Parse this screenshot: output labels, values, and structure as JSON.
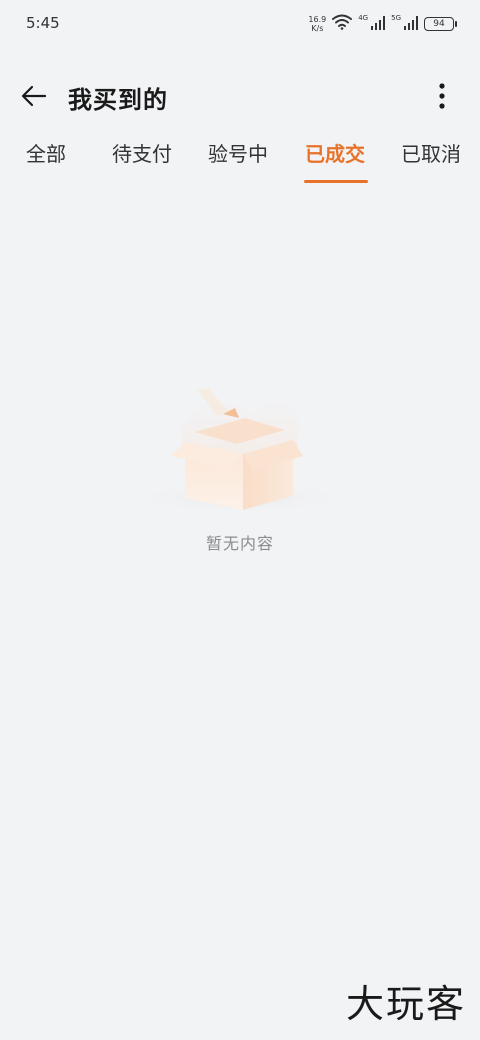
{
  "status_bar": {
    "time": "5:45",
    "net_speed_value": "16.9",
    "net_speed_unit": "K/s",
    "net_type_1": "4G",
    "net_type_2": "5G",
    "battery": "94"
  },
  "header": {
    "title": "我买到的",
    "back_icon": "arrow-left-icon",
    "more_icon": "more-vertical-icon"
  },
  "tabs": [
    {
      "label": "全部",
      "active": false
    },
    {
      "label": "待支付",
      "active": false
    },
    {
      "label": "验号中",
      "active": false
    },
    {
      "label": "已成交",
      "active": true
    },
    {
      "label": "已取消",
      "active": false
    }
  ],
  "empty_state": {
    "icon": "empty-box-icon",
    "message": "暂无内容"
  },
  "watermark": {
    "text": "大玩客"
  },
  "colors": {
    "accent": "#e8722a",
    "background": "#f2f3f5",
    "text_primary": "#1a1a1a",
    "text_muted": "#8a8c90"
  }
}
